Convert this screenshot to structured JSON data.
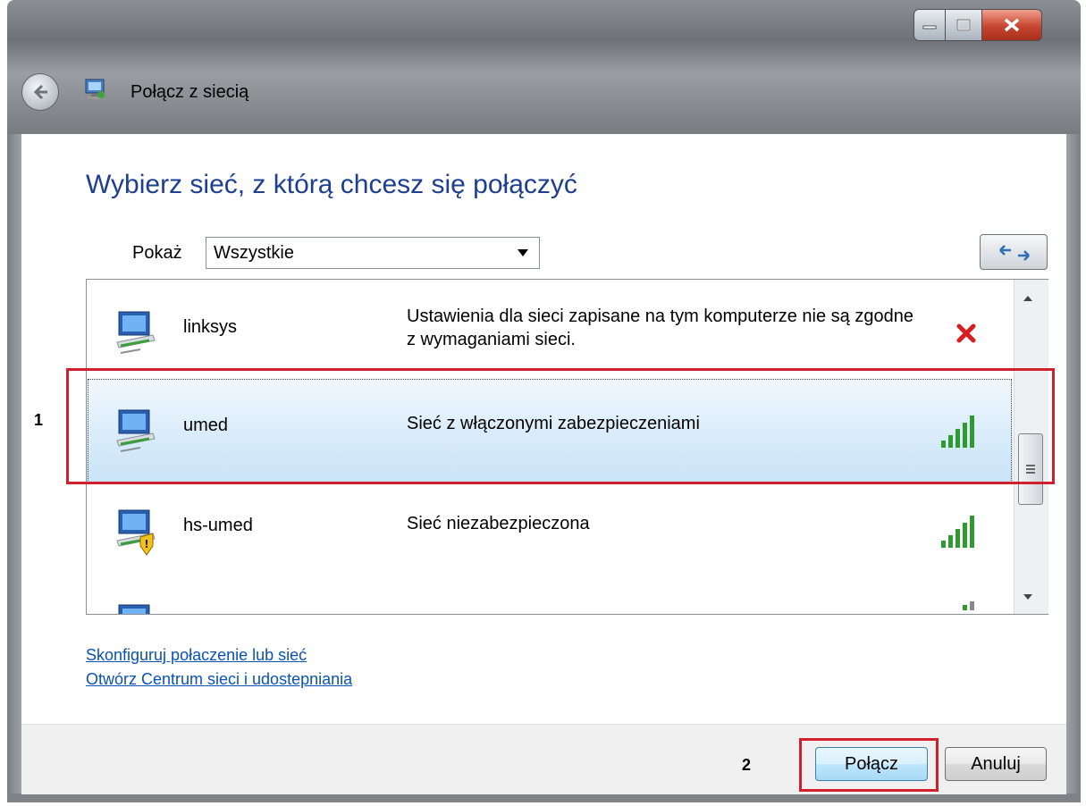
{
  "window": {
    "title": "Połącz z siecią",
    "controls": [
      "minimize-icon",
      "maximize-icon",
      "close-icon"
    ]
  },
  "heading": "Wybierz sieć, z którą chcesz się połączyć",
  "filter": {
    "label": "Pokaż",
    "selected": "Wszystkie"
  },
  "refresh_icon": "refresh-icon",
  "networks": [
    {
      "name": "linksys",
      "status": "Ustawienia dla sieci zapisane na tym komputerze nie są zgodne z wymaganiami sieci.",
      "indicator": "error-x-icon",
      "selected": false,
      "secured": true
    },
    {
      "name": "umed",
      "status": "Sieć z włączonymi zabezpieczeniami",
      "indicator": "signal-strength-icon",
      "signal_bars": 5,
      "selected": true,
      "secured": true
    },
    {
      "name": "hs-umed",
      "status": "Sieć niezabezpieczona",
      "indicator": "signal-strength-icon",
      "signal_bars": 5,
      "selected": false,
      "secured": false,
      "warning_icon": "shield-warning-icon"
    },
    {
      "name": "",
      "status": "",
      "indicator": "signal-strength-icon",
      "signal_bars": 1,
      "selected": false,
      "partially_visible": true
    }
  ],
  "links": {
    "setup": "Skonfiguruj połaczenie lub sieć",
    "network_center": "Otwórz Centrum sieci i udostepniania"
  },
  "buttons": {
    "connect": "Połącz",
    "cancel": "Anuluj"
  },
  "annotations": [
    {
      "number": "1",
      "target": "network umed"
    },
    {
      "number": "2",
      "target": "connect button"
    }
  ],
  "colors": {
    "heading": "#1e3f8f",
    "link": "#0b53b3",
    "annotation": "#d0202e",
    "signal": "#2f9a2f",
    "error": "#d81e1e"
  }
}
